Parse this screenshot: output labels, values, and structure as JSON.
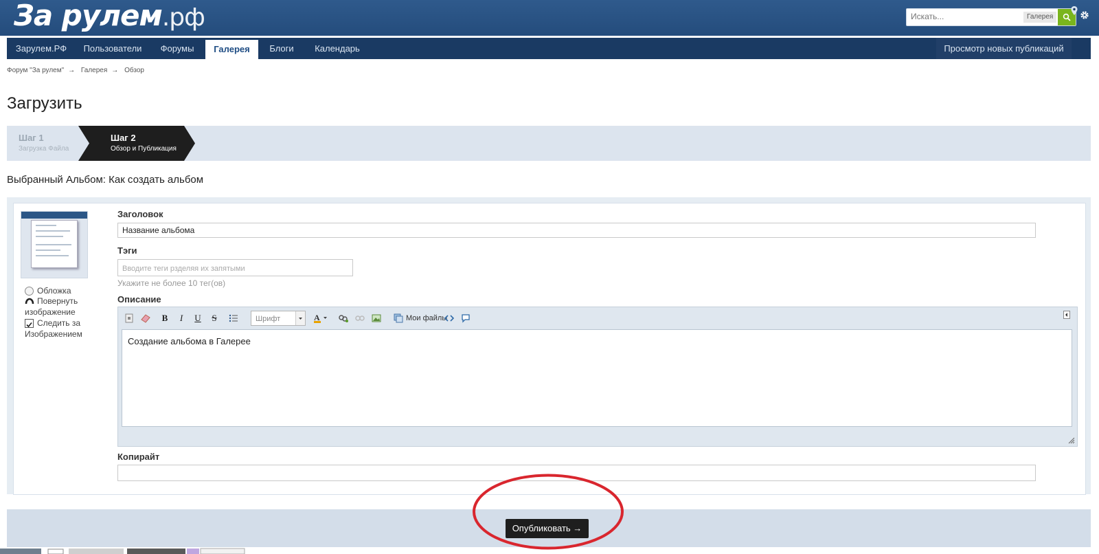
{
  "header": {
    "logo_main": "За рулем",
    "logo_suffix": ".рф",
    "search": {
      "placeholder": "Искать...",
      "scope": "Галерея"
    }
  },
  "nav": {
    "items": [
      {
        "label": "Зарулем.РФ"
      },
      {
        "label": "Пользователи"
      },
      {
        "label": "Форумы"
      },
      {
        "label": "Галерея",
        "active": true
      },
      {
        "label": "Блоги"
      },
      {
        "label": "Календарь"
      }
    ],
    "right_link": "Просмотр новых публикаций"
  },
  "breadcrumb": [
    "Форум \"За рулем\"",
    "Галерея",
    "Обзор"
  ],
  "page_title": "Загрузить",
  "steps": [
    {
      "title": "Шаг 1",
      "subtitle": "Загрузка Файла",
      "active": false
    },
    {
      "title": "Шаг 2",
      "subtitle": "Обзор и Публикация",
      "active": true
    }
  ],
  "album_line": "Выбранный Альбом: Как создать альбом",
  "image_options": {
    "cover": "Обложка",
    "rotate_line1": "Повернуть",
    "rotate_line2": "изображение",
    "follow_line1": "Следить за",
    "follow_line2": "Изображением",
    "follow_checked": true
  },
  "form": {
    "title_label": "Заголовок",
    "title_value": "Название альбома",
    "tags_label": "Тэги",
    "tags_placeholder": "Вводите теги рзделяя их запятыми",
    "tags_hint": "Укажите не более 10 тег(ов)",
    "description_label": "Описание",
    "description_value": "Создание альбома в Галерее",
    "copyright_label": "Копирайт",
    "copyright_value": ""
  },
  "editor_toolbar": {
    "font_select": "Шрифт",
    "my_files": "Мои файлы"
  },
  "publish_button": "Опубликовать →",
  "colors": {
    "header": "#2f5a8c",
    "nav": "#1a3a63",
    "search_button": "#7ab51d",
    "highlight_ellipse": "#d9262e"
  }
}
